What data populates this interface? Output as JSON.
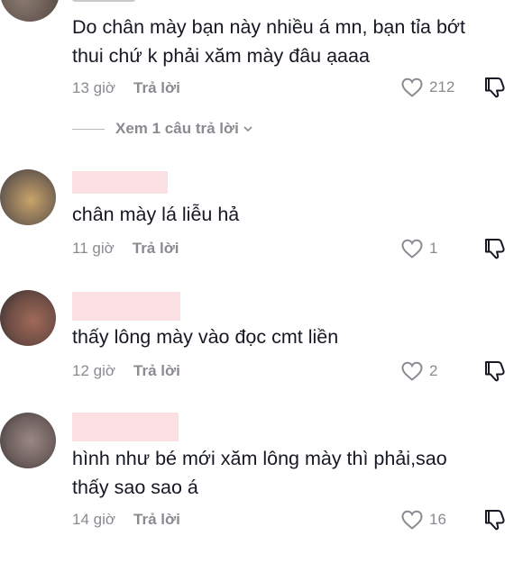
{
  "comments": [
    {
      "text": "Do chân mày bạn này nhiều á mn, bạn tỉa bớt\nthui chứ k phải xăm mày đâu ạaaa",
      "time": "13 giờ",
      "reply_label": "Trả lời",
      "likes": "212",
      "view_replies": "Xem 1 câu trả lời"
    },
    {
      "text": "chân mày lá liễu hả",
      "time": "11 giờ",
      "reply_label": "Trả lời",
      "likes": "1"
    },
    {
      "text": "thấy lông mày vào đọc cmt liền",
      "time": "12 giờ",
      "reply_label": "Trả lời",
      "likes": "2"
    },
    {
      "text": "hình như bé mới xăm lông mày thì phải,sao\nthấy sao sao á",
      "time": "14 giờ",
      "reply_label": "Trả lời",
      "likes": "16"
    }
  ],
  "colors": {
    "text": "#161823",
    "muted": "#8a8b91",
    "redaction": "#fbe0e3"
  },
  "icons": {
    "like": "heart-outline-icon",
    "dislike": "thumbs-down-icon",
    "expand": "chevron-down-icon"
  }
}
